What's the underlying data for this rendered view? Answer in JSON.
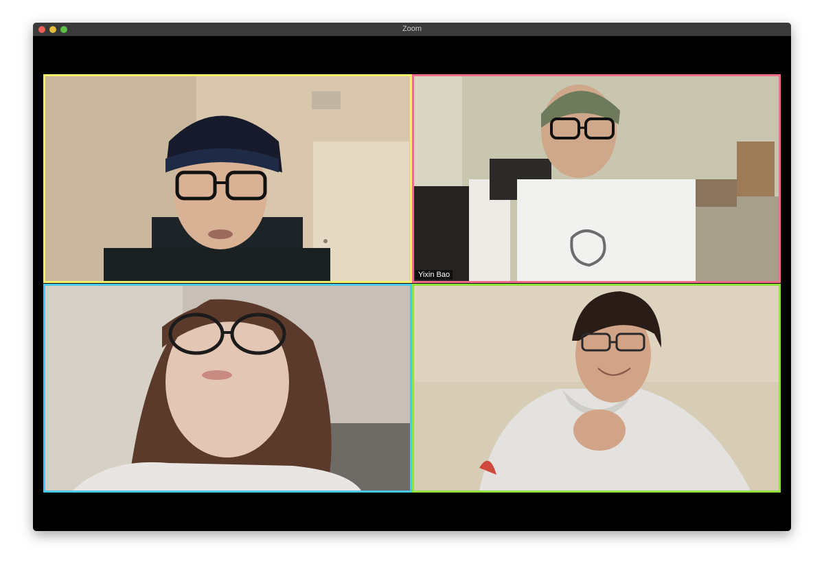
{
  "window": {
    "title": "Zoom"
  },
  "participants": [
    {
      "name": "",
      "border_color": "#f5f06a"
    },
    {
      "name": "Yixin Bao",
      "border_color": "#f06b8c"
    },
    {
      "name": "",
      "border_color": "#49c8ea"
    },
    {
      "name": "",
      "border_color": "#93e33e"
    }
  ]
}
